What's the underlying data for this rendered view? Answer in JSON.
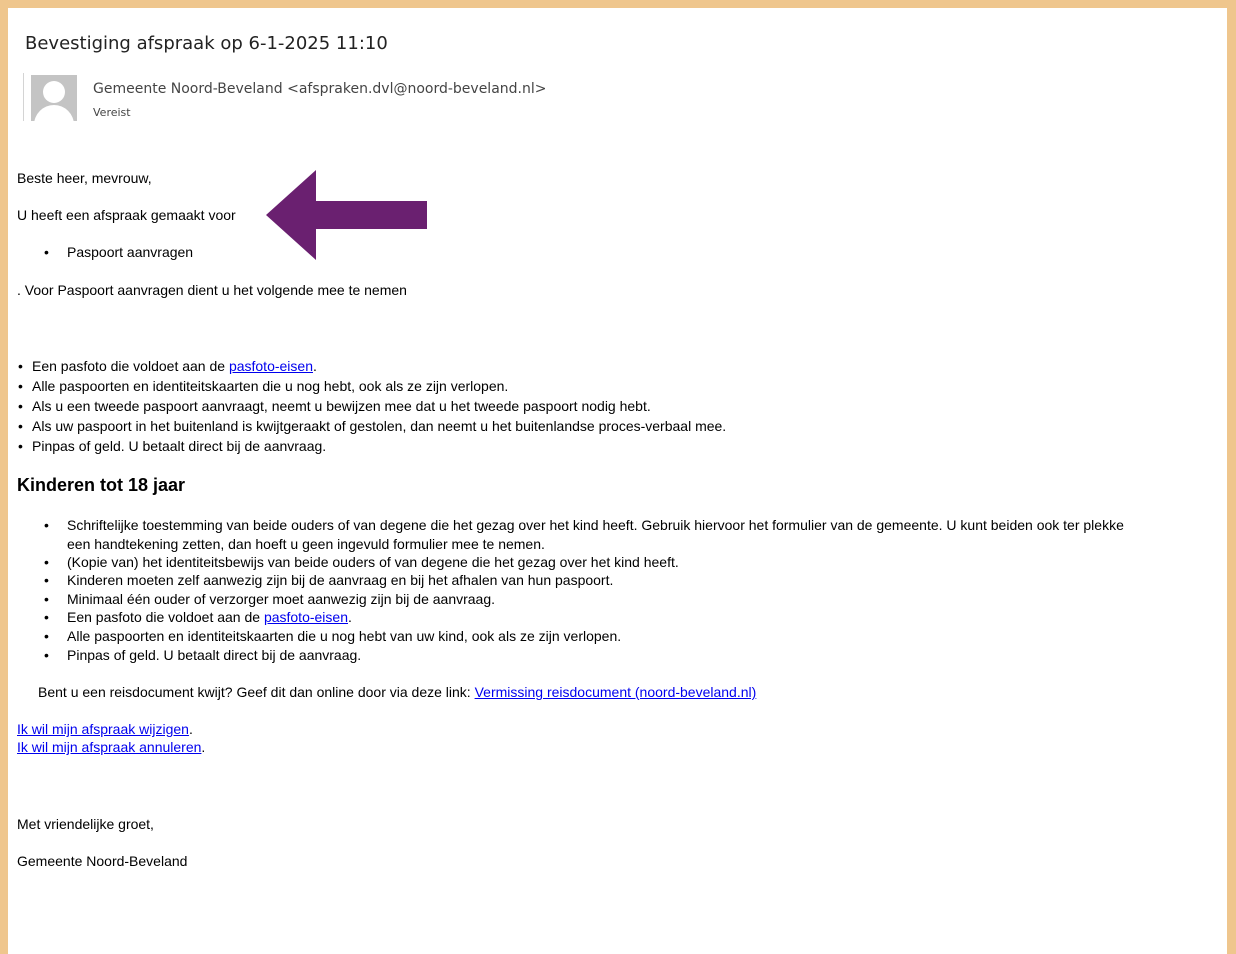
{
  "email": {
    "subject": "Bevestiging afspraak op 6-1-2025 11:10",
    "sender": "Gemeente Noord-Beveland <afspraken.dvl@noord-beveland.nl>",
    "sender_status": "Vereist",
    "accent_color": "#efc68d",
    "arrow_color": "#6a2070"
  },
  "body": {
    "greeting": "Beste heer, mevrouw,",
    "intro": "U heeft een afspraak gemaakt voor",
    "appointment_item": "Paspoort aanvragen",
    "requirements_intro": ". Voor Paspoort aanvragen dient u het volgende mee te nemen",
    "requirements": [
      {
        "text": "Een pasfoto die voldoet aan de ",
        "link": "pasfoto-eisen",
        "suffix": "."
      },
      {
        "text": "Alle paspoorten en identiteitskaarten die u nog hebt, ook als ze zijn verlopen."
      },
      {
        "text": "Als u een tweede paspoort aanvraagt, neemt u bewijzen mee dat u het tweede paspoort nodig hebt."
      },
      {
        "text": "Als uw paspoort in het buitenland is kwijtgeraakt of gestolen, dan neemt u het buitenlandse proces-verbaal mee."
      },
      {
        "text": "Pinpas of geld. U betaalt direct bij de aanvraag."
      }
    ],
    "children_heading": "Kinderen tot 18 jaar",
    "children_items": [
      {
        "line1": "Schriftelijke toestemming van beide ouders of van degene die het gezag over het kind heeft. Gebruik hiervoor het formulier van de gemeente. U kunt beiden ook ter plekke",
        "line2": "een handtekening zetten, dan hoeft u geen ingevuld formulier mee te nemen."
      },
      {
        "line1": "(Kopie van) het identiteitsbewijs van beide ouders of van degene die het gezag over het kind heeft."
      },
      {
        "line1": "Kinderen moeten zelf aanwezig zijn bij de aanvraag en bij het afhalen van hun paspoort."
      },
      {
        "line1": "Minimaal één ouder of verzorger moet aanwezig zijn bij de aanvraag."
      },
      {
        "line1": "Een pasfoto die voldoet aan de ",
        "link": "pasfoto-eisen",
        "suffix": "."
      },
      {
        "line1": "Alle paspoorten en identiteitskaarten die u nog hebt van uw kind, ook als ze zijn verlopen."
      },
      {
        "line1": "Pinpas of geld. U betaalt direct bij de aanvraag."
      }
    ],
    "lost_doc_text": "Bent u een reisdocument kwijt? Geef dit dan online door via deze link: ",
    "lost_doc_link": "Vermissing reisdocument (noord-beveland.nl)",
    "change_link": "Ik wil mijn afspraak wijzigen",
    "cancel_link": "Ik wil mijn afspraak annuleren",
    "period": ".",
    "closing": "Met vriendelijke groet,",
    "signature": "Gemeente Noord-Beveland"
  }
}
